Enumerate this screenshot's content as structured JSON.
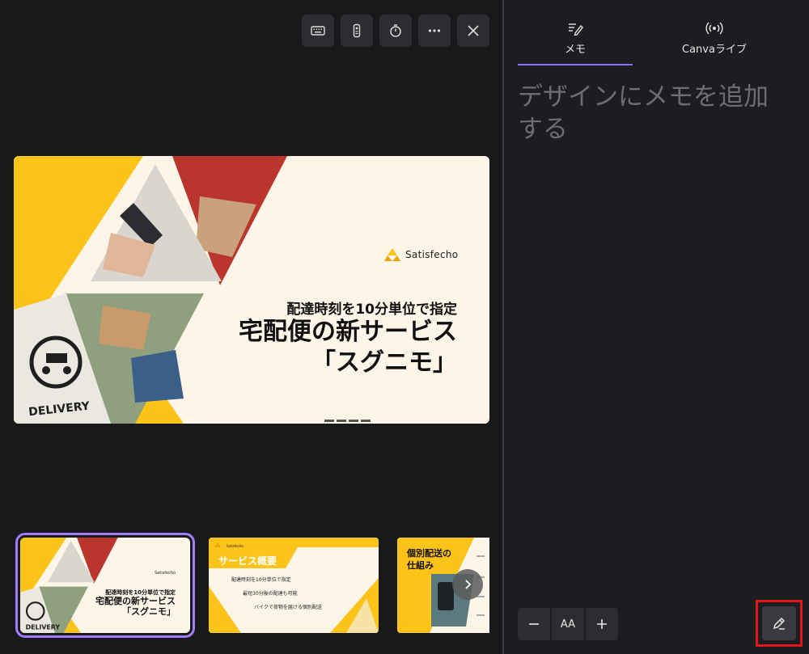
{
  "toolbar": {
    "icons": [
      "keyboard-icon",
      "remote-icon",
      "timer-icon",
      "more-icon",
      "close-icon"
    ]
  },
  "slide": {
    "brand": "Satisfecho",
    "subtitle": "配達時刻を10分単位で指定",
    "title_line1": "宅配便の新サービス",
    "title_line2": "「スグニモ」",
    "badge": "DELIVERY"
  },
  "thumbnails": [
    {
      "brand": "Satisfecho",
      "subtitle": "配達時刻を10分単位で指定",
      "title_line1": "宅配便の新サービス",
      "title_line2": "「スグニモ」",
      "badge": "DELIVERY"
    },
    {
      "brand": "Satisfecho",
      "heading": "サービス概要",
      "items": [
        "配達時刻を10分単位で指定",
        "最短30分後の配達も可能",
        "バイクで荷物を届ける個別配送"
      ]
    },
    {
      "heading_line1": "個別配送の",
      "heading_line2": "仕組み"
    }
  ],
  "panel": {
    "tabs": [
      {
        "label": "メモ",
        "icon": "notes-icon"
      },
      {
        "label": "Canvaライブ",
        "icon": "broadcast-icon"
      }
    ],
    "notes_placeholder": "デザインにメモを追加する",
    "font_size_label": "AA"
  },
  "colors": {
    "accent": "#8b6cf0",
    "brand_yellow": "#fcc419",
    "slide_bg": "#fdf6e8",
    "highlight": "#e3161a"
  }
}
